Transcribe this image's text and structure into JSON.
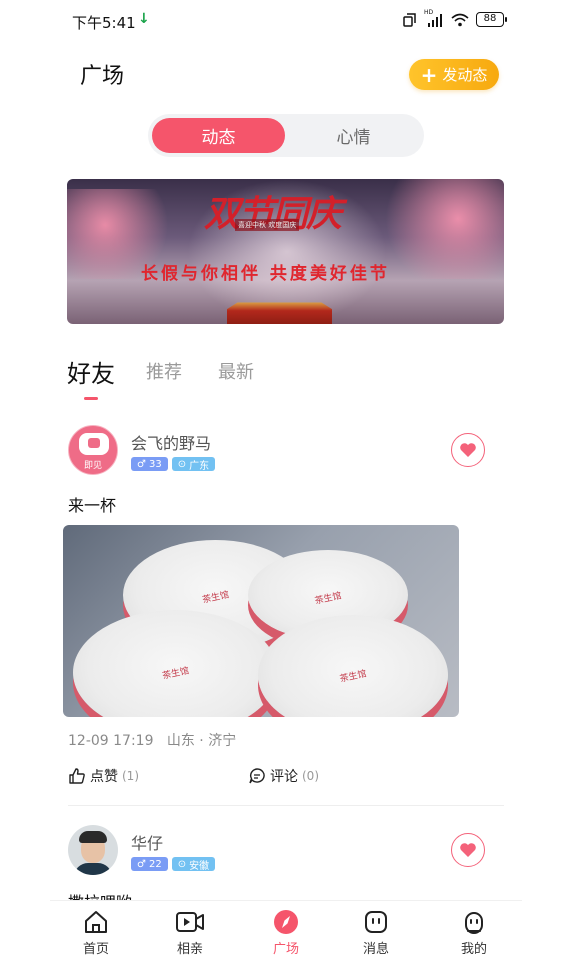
{
  "status_bar": {
    "time": "下午5:41",
    "download_icon": "download-arrow-icon",
    "network": "HD",
    "battery": "88"
  },
  "header": {
    "title": "广场",
    "post_button": "发动态"
  },
  "segment": {
    "active": "动态",
    "inactive": "心情"
  },
  "banner": {
    "title": "双节同庆",
    "subtitle": "长假与你相伴 共度美好佳节",
    "small_text": "喜迎中秋 欢度国庆"
  },
  "sub_tabs": [
    "好友",
    "推荐",
    "最新"
  ],
  "posts": [
    {
      "username": "会飞的野马",
      "avatar_label": "即见",
      "age": "33",
      "location": "广东",
      "text": "来一杯",
      "time": "12-09 17:19",
      "place": "山东 · 济宁",
      "like_label": "点赞",
      "like_count": "(1)",
      "comment_label": "评论",
      "comment_count": "(0)"
    },
    {
      "username": "华仔",
      "age": "22",
      "location": "安徽",
      "text": "撒拉哩哟"
    }
  ],
  "photo_labels": [
    "茶生馆",
    "茶生馆",
    "茶生馆",
    "茶生馆"
  ],
  "tab_bar": [
    {
      "label": "首页",
      "icon": "home-icon"
    },
    {
      "label": "相亲",
      "icon": "video-icon"
    },
    {
      "label": "广场",
      "icon": "compass-icon"
    },
    {
      "label": "消息",
      "icon": "message-icon"
    },
    {
      "label": "我的",
      "icon": "profile-icon"
    }
  ],
  "colors": {
    "accent": "#f5556b",
    "post_button": "#f7a90f",
    "tag_age": "#7a9cf5",
    "tag_location": "#72c1f2"
  }
}
